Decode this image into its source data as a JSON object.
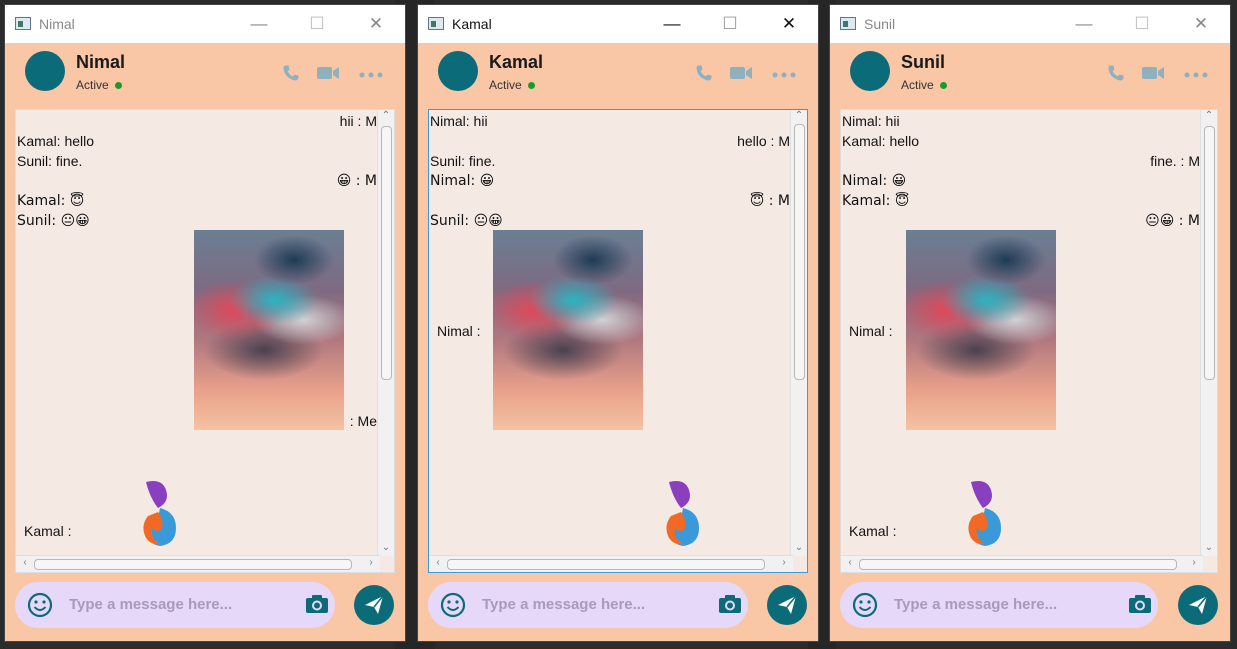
{
  "windows": [
    {
      "title": "Nimal",
      "contact": "Nimal",
      "status": "Active",
      "messages": [
        {
          "text": "hii : M",
          "side": "right"
        },
        {
          "text": "Kamal: hello",
          "side": "left"
        },
        {
          "text": "Sunil: fine.",
          "side": "left"
        },
        {
          "text": "😀 : M",
          "side": "right"
        },
        {
          "text": "Kamal: 😇",
          "side": "left"
        },
        {
          "text": "Sunil: 😐😀",
          "side": "left"
        },
        {
          "text": ": Me",
          "side": "right"
        },
        {
          "text": "Kamal :",
          "side": "left"
        }
      ],
      "placeholder": "Type a message here..."
    },
    {
      "title": "Kamal",
      "contact": "Kamal",
      "status": "Active",
      "messages": [
        {
          "text": "Nimal: hii",
          "side": "left"
        },
        {
          "text": "hello : M",
          "side": "right"
        },
        {
          "text": "Sunil: fine.",
          "side": "left"
        },
        {
          "text": "Nimal: 😀",
          "side": "left"
        },
        {
          "text": "😇 : M",
          "side": "right"
        },
        {
          "text": "Sunil: 😐😀",
          "side": "left"
        },
        {
          "text": "Nimal :",
          "side": "left"
        }
      ],
      "placeholder": "Type a message here..."
    },
    {
      "title": "Sunil",
      "contact": "Sunil",
      "status": "Active",
      "messages": [
        {
          "text": "Nimal: hii",
          "side": "left"
        },
        {
          "text": "Kamal: hello",
          "side": "left"
        },
        {
          "text": "fine. : M",
          "side": "right"
        },
        {
          "text": "Nimal: 😀",
          "side": "left"
        },
        {
          "text": "Kamal: 😇",
          "side": "left"
        },
        {
          "text": "😐😀 : M",
          "side": "right"
        },
        {
          "text": "Nimal :",
          "side": "left"
        },
        {
          "text": "Kamal :",
          "side": "left"
        }
      ],
      "placeholder": "Type a message here..."
    }
  ],
  "icons": {
    "phone": "phone-icon",
    "video": "video-icon",
    "more": "more-icon",
    "emoji": "smile-icon",
    "camera": "camera-icon",
    "send": "send-icon"
  },
  "colors": {
    "panel": "#f9c6a6",
    "chat_bg": "#f5e9e4",
    "accent": "#0c6b78",
    "input": "#e5d8f9",
    "active_dot": "#1a9a2a"
  }
}
